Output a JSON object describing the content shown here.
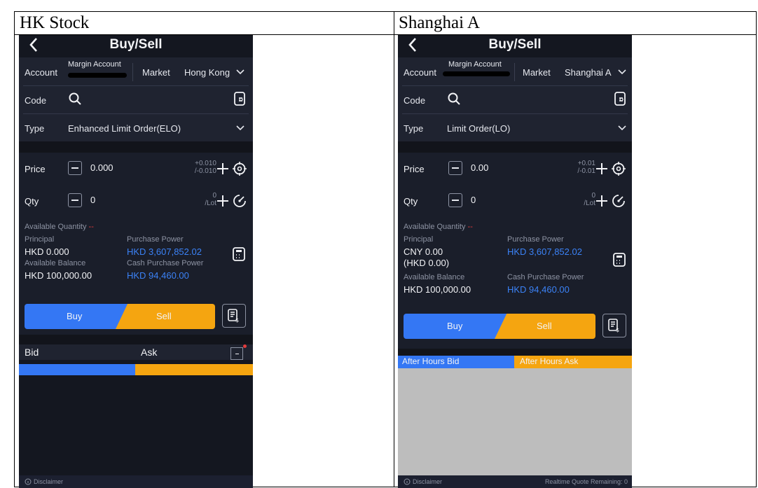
{
  "columns": {
    "left_title": "HK Stock",
    "right_title": "Shanghai A"
  },
  "screens": [
    {
      "nav_title": "Buy/Sell",
      "account_label": "Account",
      "account_value": "Margin Account",
      "market_label": "Market",
      "market_value": "Hong Kong",
      "code_label": "Code",
      "type_label": "Type",
      "type_value": "Enhanced Limit Order(ELO)",
      "price_label": "Price",
      "price_value": "0.000",
      "price_step_up": "+0.010",
      "price_step_down": "/-0.010",
      "qty_label": "Qty",
      "qty_value": "0",
      "qty_lot_count": "0",
      "qty_lot_unit": "/Lot",
      "available_qty_label": "Available Quantity",
      "available_qty_value": "--",
      "principal_label": "Principal",
      "principal_value": "HKD 0.000",
      "principal_value_2": "",
      "purchase_power_label": "Purchase Power",
      "purchase_power_value": "HKD 3,607,852.02",
      "available_balance_label": "Available Balance",
      "available_balance_value": "HKD 100,000.00",
      "cash_purchase_power_label": "Cash Purchase Power",
      "cash_purchase_power_value": "HKD 94,460.00",
      "buy_label": "Buy",
      "sell_label": "Sell",
      "bid_label": "Bid",
      "ask_label": "Ask",
      "disclaimer_label": "Disclaimer",
      "quote_remaining": ""
    },
    {
      "nav_title": "Buy/Sell",
      "account_label": "Account",
      "account_value": "Margin Account",
      "market_label": "Market",
      "market_value": "Shanghai A",
      "code_label": "Code",
      "type_label": "Type",
      "type_value": "Limit Order(LO)",
      "price_label": "Price",
      "price_value": "0.00",
      "price_step_up": "+0.01",
      "price_step_down": "/-0.01",
      "qty_label": "Qty",
      "qty_value": "0",
      "qty_lot_count": "0",
      "qty_lot_unit": "/Lot",
      "available_qty_label": "Available Quantity",
      "available_qty_value": "--",
      "principal_label": "Principal",
      "principal_value": "CNY 0.00",
      "principal_value_2": "(HKD 0.00)",
      "purchase_power_label": "Purchase Power",
      "purchase_power_value": "HKD 3,607,852.02",
      "available_balance_label": "Available Balance",
      "available_balance_value": "HKD 100,000.00",
      "cash_purchase_power_label": "Cash Purchase Power",
      "cash_purchase_power_value": "HKD 94,460.00",
      "buy_label": "Buy",
      "sell_label": "Sell",
      "bid_label": "After Hours Bid",
      "ask_label": "After Hours Ask",
      "disclaimer_label": "Disclaimer",
      "quote_remaining": "Realtime Quote Remaining: 0"
    }
  ],
  "colors": {
    "background": "#141720",
    "buy": "#3477f4",
    "sell": "#f5a510",
    "link_blue": "#3b82f6",
    "alert_red": "#e33b3b",
    "grey_panel": "#bdbdbd"
  },
  "icons": [
    "back-arrow-icon",
    "search-icon",
    "stock-list-icon",
    "chevron-down-icon",
    "minus-icon",
    "plus-icon",
    "target-icon",
    "gauge-icon",
    "calculator-icon",
    "ledger-icon",
    "info-icon",
    "collapse-icon"
  ]
}
